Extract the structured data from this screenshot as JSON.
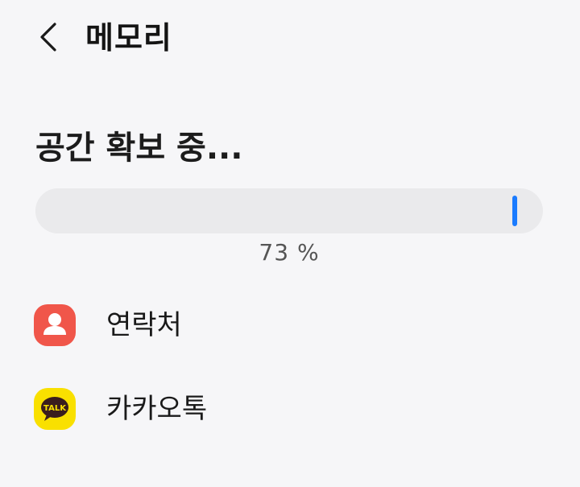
{
  "header": {
    "back_icon": "chevron-left-icon",
    "title": "메모리"
  },
  "status": {
    "title": "공간 확보 중...",
    "progress_fraction": 0.73,
    "percent_label": "73 %",
    "accent_color": "#1a7bff"
  },
  "apps": [
    {
      "label": "연락처",
      "icon": "contacts-icon",
      "color": "#f0564a"
    },
    {
      "label": "카카오톡",
      "icon": "kakaotalk-icon",
      "color": "#f9e000",
      "icon_text": "TALK"
    }
  ]
}
